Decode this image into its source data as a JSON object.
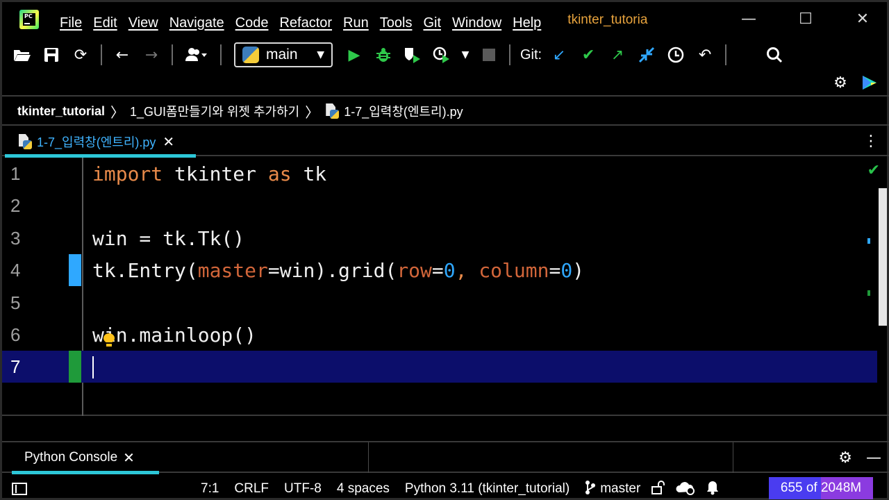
{
  "menu": {
    "items": [
      "File",
      "Edit",
      "View",
      "Navigate",
      "Code",
      "Refactor",
      "Run",
      "Tools",
      "Git",
      "Window",
      "Help"
    ],
    "project_title": "tkinter_tutoria"
  },
  "toolbar": {
    "branch_selector": "main",
    "git_label": "Git:",
    "icons": [
      "open-folder-icon",
      "save-icon",
      "sync-icon",
      "back-arrow-icon",
      "forward-arrow-icon",
      "user-icon",
      "python-icon",
      "run-icon",
      "debug-icon",
      "coverage-icon",
      "profile-icon",
      "stop-icon",
      "git-update-icon",
      "git-commit-icon",
      "git-push-icon",
      "git-merge-icon",
      "history-icon",
      "rollback-icon",
      "search-icon",
      "settings-icon",
      "plugin-icon"
    ]
  },
  "breadcrumb": {
    "project": "tkinter_tutorial",
    "folder": "1_GUI폼만들기와 위젯 추가하기",
    "file": "1-7_입력창(엔트리).py"
  },
  "editor_tab": {
    "label": "1-7_입력창(엔트리).py",
    "close": "✕"
  },
  "code": {
    "line_numbers": [
      "1",
      "2",
      "3",
      "4",
      "5",
      "6",
      "7"
    ],
    "l1_kw1": "import",
    "l1_a": " tkinter ",
    "l1_kw2": "as",
    "l1_b": " tk",
    "l3": "win = tk.Tk()",
    "l4_a": "tk.Entry(",
    "l4_p1": "master",
    "l4_b": "=win).grid(",
    "l4_p2": "row",
    "l4_c": "=",
    "l4_n1": "0",
    "l4_d": ", ",
    "l4_p3": "column",
    "l4_e": "=",
    "l4_n2": "0",
    "l4_f": ")",
    "l6": "win.mainloop()",
    "current_line": 7
  },
  "bottom_panel": {
    "tab_label": "Python Console",
    "close": "✕"
  },
  "status": {
    "position": "7:1",
    "line_separator": "CRLF",
    "encoding": "UTF-8",
    "indent": "4 spaces",
    "interpreter": "Python 3.11 (tkinter_tutorial)",
    "branch": "master",
    "memory_used": 655,
    "memory_total": 2048,
    "memory_text": "655 of 2048M"
  },
  "colors": {
    "keyword": "#e88a4a",
    "parameter": "#d2663a",
    "number": "#2fa8ff",
    "tab_accent": "#2dc7d8",
    "current_line": "#0c0e6b",
    "project_title": "#e8a33d"
  }
}
